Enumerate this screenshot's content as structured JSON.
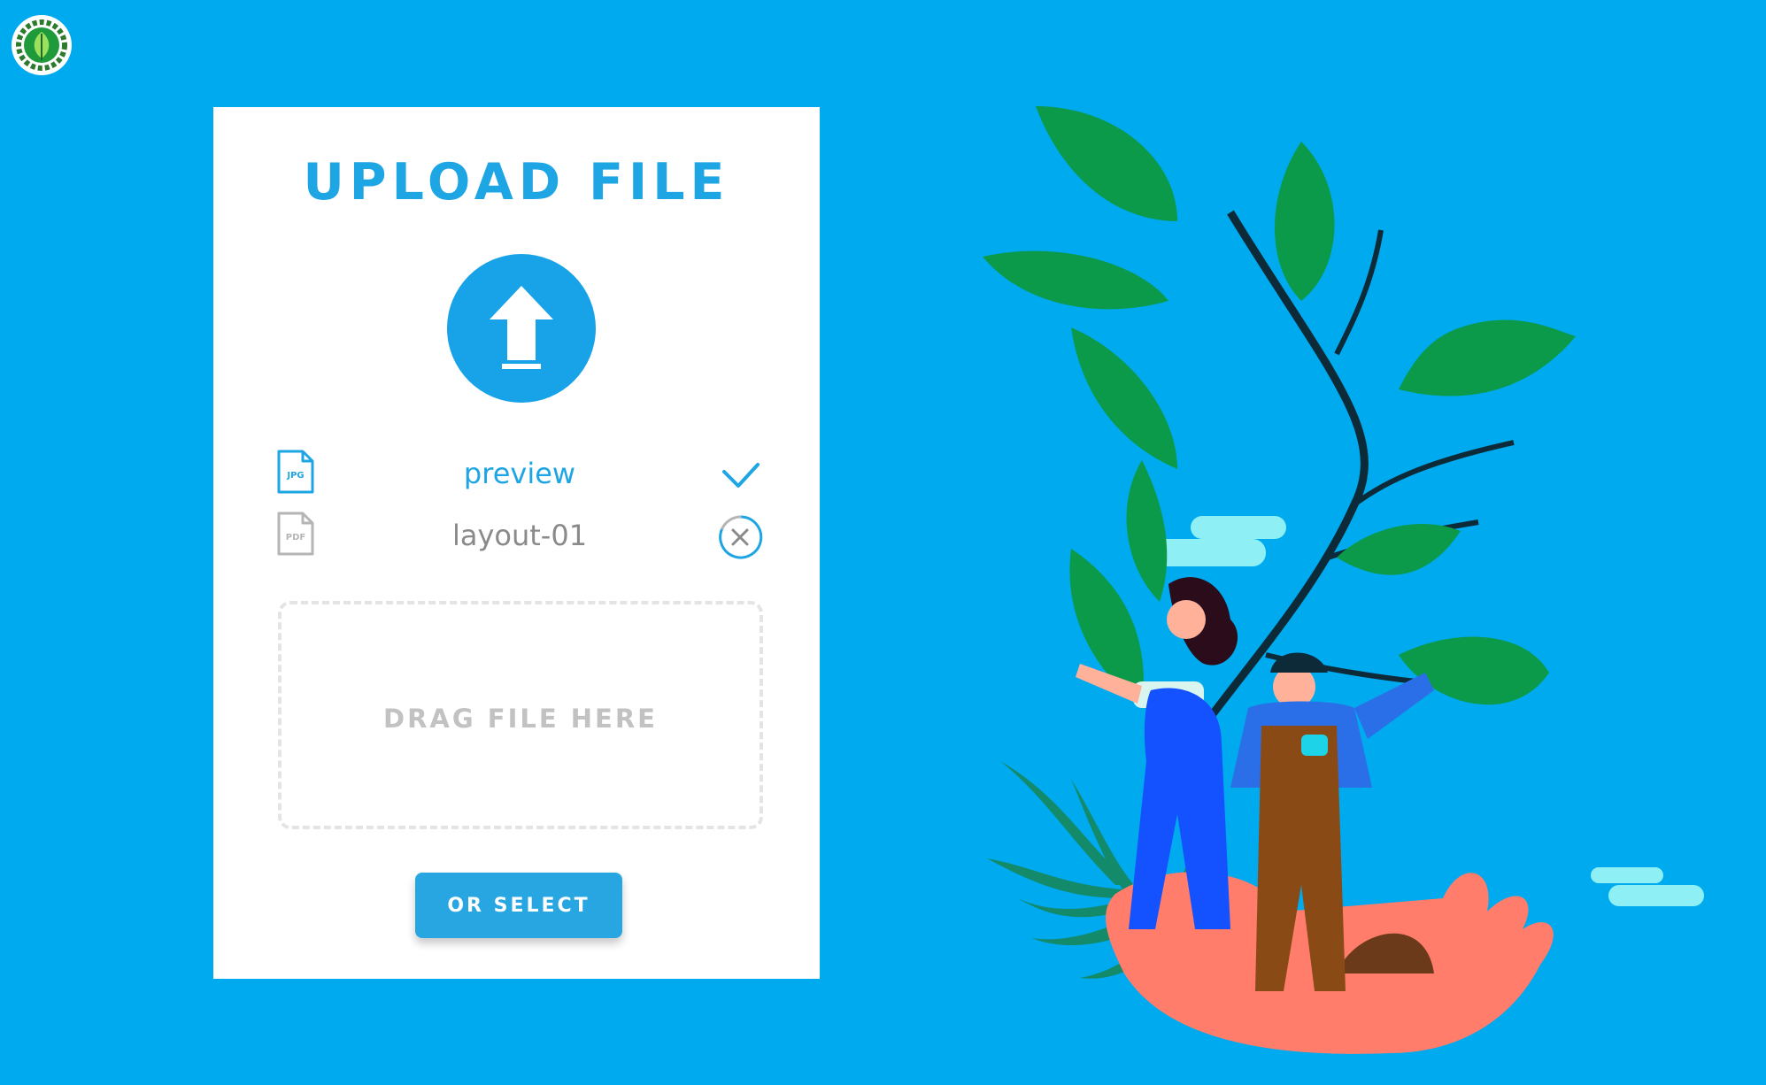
{
  "logo": {
    "icon": "leaf-gear-logo"
  },
  "card": {
    "title": "UPLOAD FILE",
    "upload_icon": "upload-arrow-icon",
    "files": [
      {
        "type_label": "JPG",
        "name": "preview",
        "status": "complete",
        "status_icon": "checkmark-icon"
      },
      {
        "type_label": "PDF",
        "name": "layout-01",
        "status": "removable",
        "status_icon": "close-circle-icon"
      }
    ],
    "dropzone_label": "DRAG FILE HERE",
    "select_button": "OR SELECT"
  },
  "colors": {
    "background": "#00aaee",
    "accent": "#1ea5e3",
    "card": "#ffffff",
    "muted": "#8a8a8a"
  }
}
